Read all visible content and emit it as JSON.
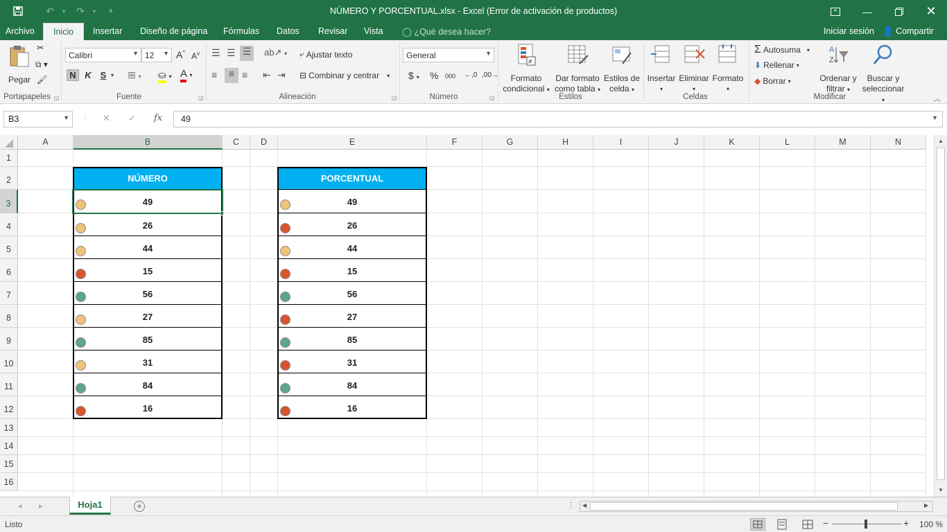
{
  "window": {
    "title": "NÚMERO Y PORCENTUAL.xlsx - Excel (Error de activación de productos)"
  },
  "ribbon_tabs": [
    "Archivo",
    "Inicio",
    "Insertar",
    "Diseño de página",
    "Fórmulas",
    "Datos",
    "Revisar",
    "Vista"
  ],
  "tell_me": "¿Qué desea hacer?",
  "account": {
    "signin": "Iniciar sesión",
    "share": "Compartir"
  },
  "clipboard": {
    "paste": "Pegar",
    "label": "Portapapeles"
  },
  "font": {
    "name": "Calibri",
    "size": "12",
    "bold": "N",
    "italic": "K",
    "underline": "S",
    "label": "Fuente"
  },
  "alignment": {
    "wrap": "Ajustar texto",
    "merge": "Combinar y centrar",
    "label": "Alineación"
  },
  "number": {
    "format": "General",
    "currency": "$",
    "percent": "%",
    "thousands": "000",
    "label": "Número"
  },
  "styles": {
    "conditional_1": "Formato",
    "conditional_2": "condicional",
    "table_1": "Dar formato",
    "table_2": "como tabla",
    "cell_1": "Estilos de",
    "cell_2": "celda",
    "label": "Estilos"
  },
  "cells": {
    "insert": "Insertar",
    "delete": "Eliminar",
    "format": "Formato",
    "label": "Celdas"
  },
  "editing": {
    "autosum": "Autosuma",
    "fill": "Rellenar",
    "clear": "Borrar",
    "sort_1": "Ordenar y",
    "sort_2": "filtrar",
    "find_1": "Buscar y",
    "find_2": "seleccionar",
    "label": "Modificar"
  },
  "formula_bar": {
    "name_box": "B3",
    "value": "49",
    "fx": "fx"
  },
  "columns": [
    "A",
    "B",
    "C",
    "D",
    "E",
    "F",
    "G",
    "H",
    "I",
    "J",
    "K",
    "L",
    "M",
    "N"
  ],
  "rows": [
    "1",
    "2",
    "3",
    "4",
    "5",
    "6",
    "7",
    "8",
    "9",
    "10",
    "11",
    "12",
    "13",
    "14",
    "15",
    "16"
  ],
  "colors": {
    "excel_green": "#217346",
    "header_blue": "#00b0f0",
    "dot_yellow": "#f0c37a",
    "dot_red": "#d9542f",
    "dot_green": "#5fa58a"
  },
  "table_numero": {
    "header": "NÚMERO",
    "values": [
      "49",
      "26",
      "44",
      "15",
      "56",
      "27",
      "85",
      "31",
      "84",
      "16"
    ],
    "icons": [
      "yellow",
      "yellow",
      "yellow",
      "red",
      "green",
      "yellow",
      "green",
      "yellow",
      "green",
      "red"
    ]
  },
  "table_porcentual": {
    "header": "PORCENTUAL",
    "values": [
      "49",
      "26",
      "44",
      "15",
      "56",
      "27",
      "85",
      "31",
      "84",
      "16"
    ],
    "icons": [
      "yellow",
      "red",
      "yellow",
      "red",
      "green",
      "red",
      "green",
      "red",
      "green",
      "red"
    ]
  },
  "sheet": {
    "name": "Hoja1"
  },
  "status": {
    "text": "Listo",
    "zoom": "100 %"
  }
}
